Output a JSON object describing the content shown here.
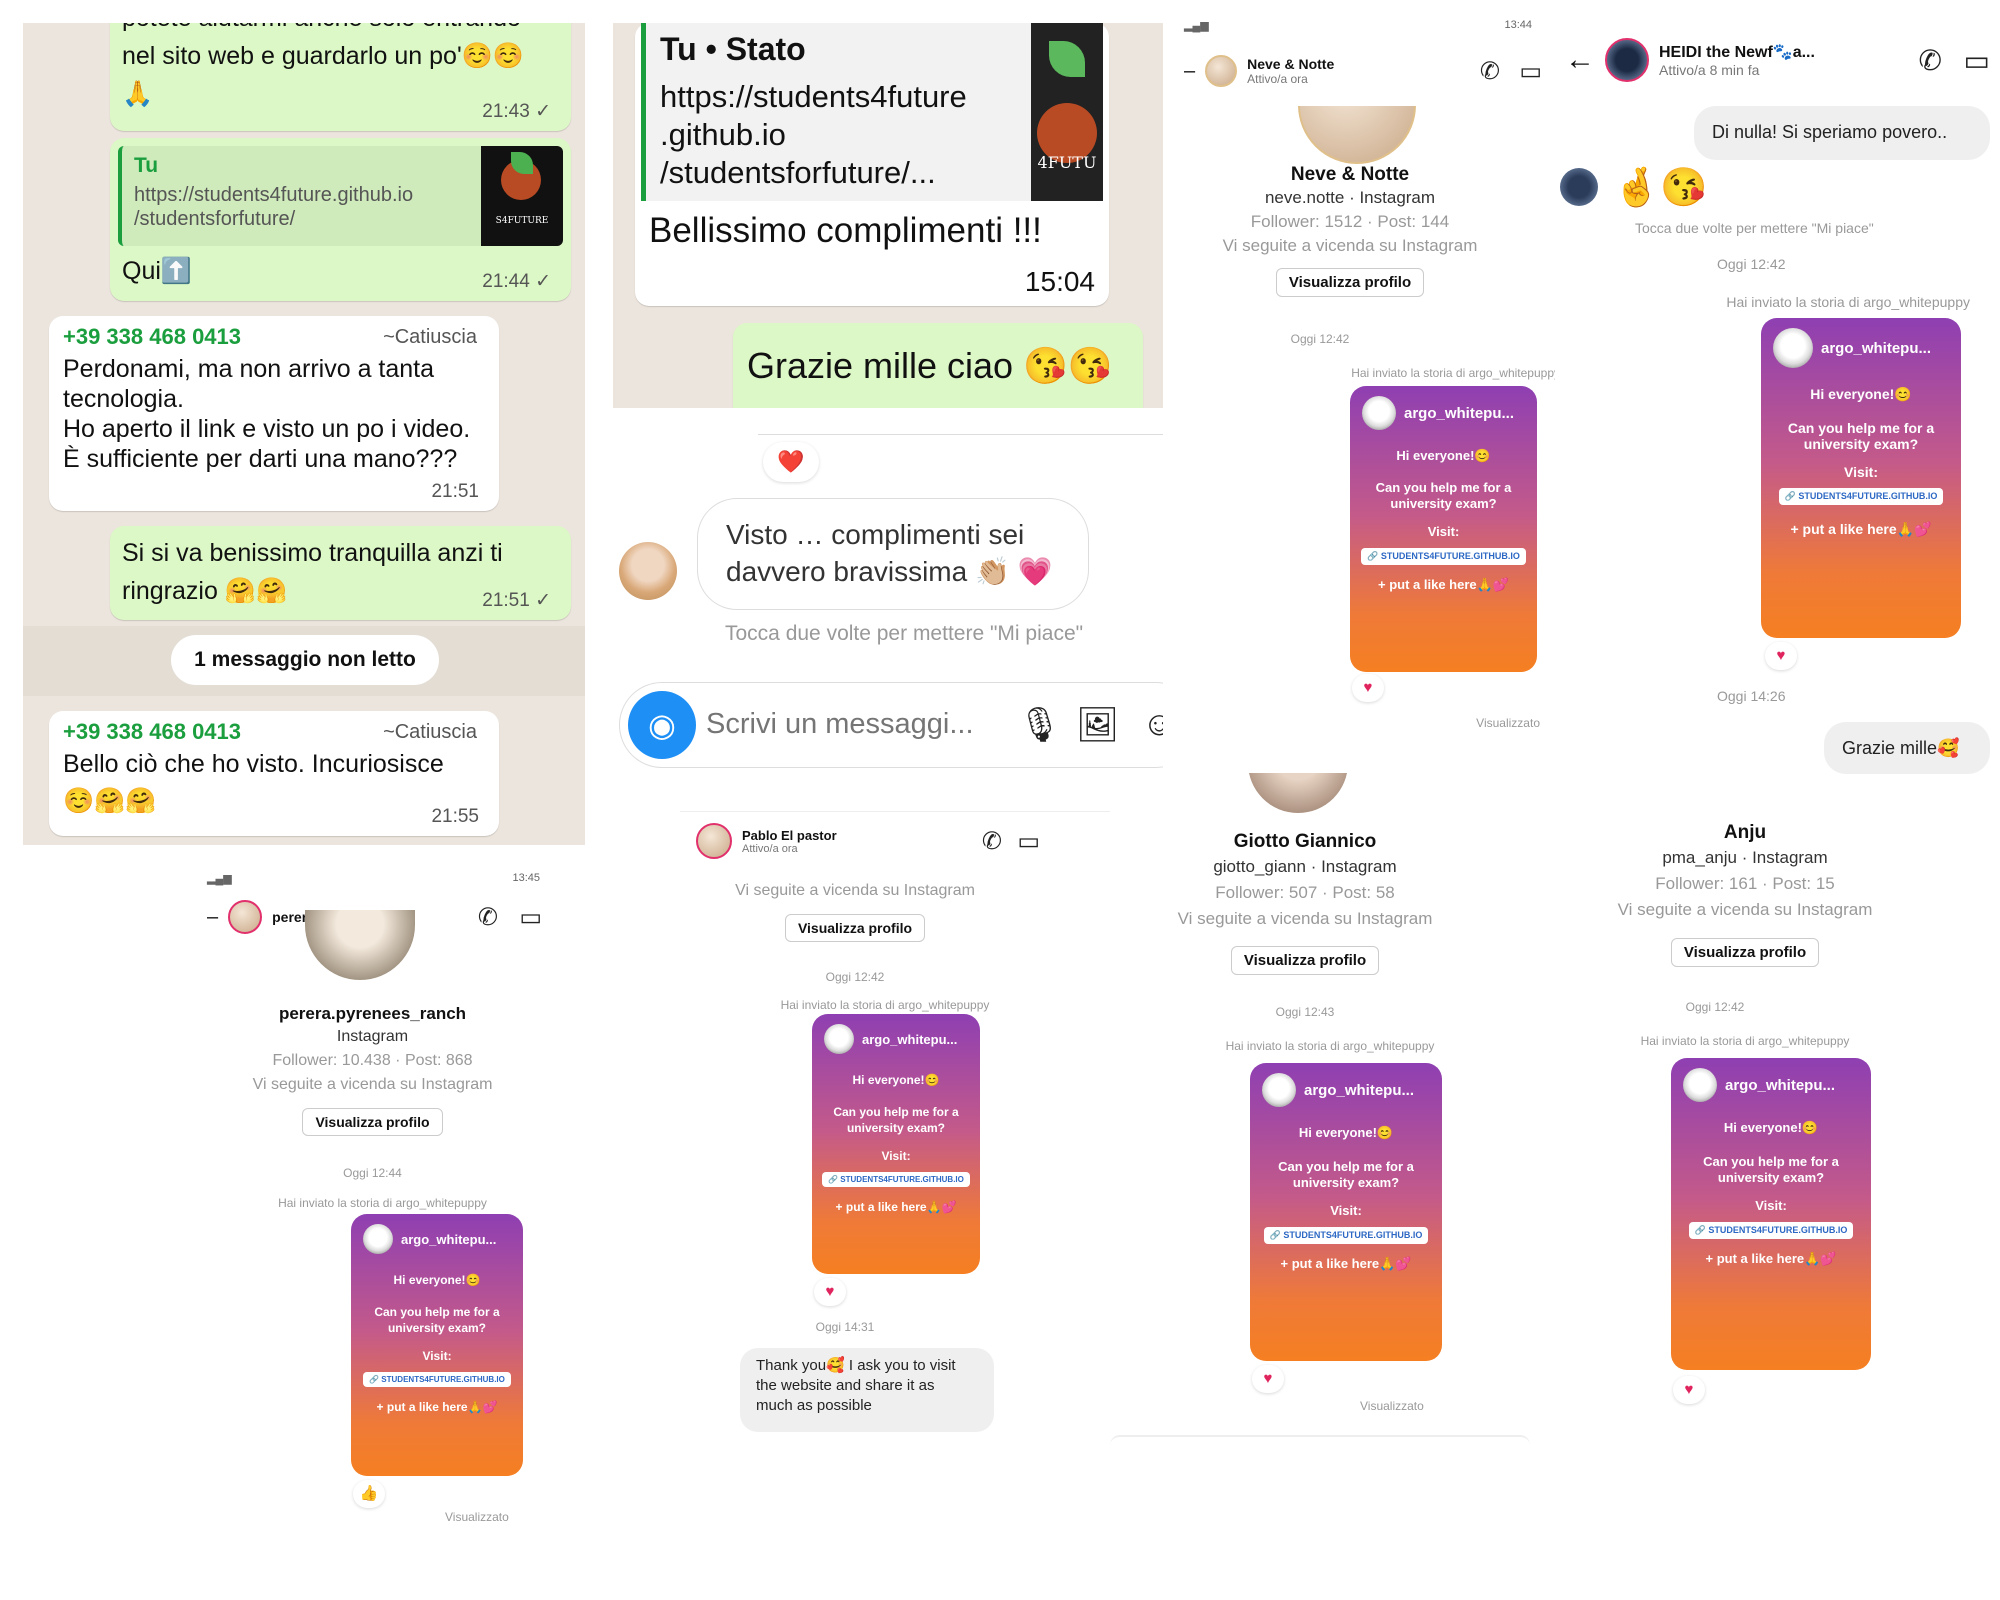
{
  "whatsapp": {
    "msg1": {
      "text_top": "potete aiutarmi anche solo entrando",
      "text": "nel sito web e guardarlo un po'☺️☺️",
      "emoji2": "🙏",
      "time": "21:43 ✓"
    },
    "msg2": {
      "quote_sender": "Tu",
      "quote_link": "https://students4future.github.io/studentsforfuture/",
      "link1": "https://students4future.github.io",
      "link2": "/studentsforfuture/",
      "text": "Qui⬆️",
      "time": "21:44 ✓",
      "logo": "S4FUTURE"
    },
    "msg3": {
      "sender": "+39 338 468 0413",
      "alias": "~Catiuscia",
      "line1": "Perdonami, ma non arrivo a tanta",
      "line2": "tecnologia.",
      "line3": "Ho aperto il link e visto un po i video.",
      "line4": "È sufficiente per darti una mano???",
      "time": "21:51"
    },
    "msg4": {
      "line1": "Si si va benissimo tranquilla anzi ti",
      "line2": "ringrazio 🤗🤗",
      "time": "21:51 ✓"
    },
    "unread": "1 messaggio non letto",
    "msg5": {
      "sender": "+39 338 468 0413",
      "alias": "~Catiuscia",
      "line1": "Bello ciò che ho visto. Incuriosisce",
      "line2": "☺️🤗🤗",
      "time": "21:55"
    }
  },
  "stato": {
    "quote_title": "Tu • Stato",
    "quote_l1": "https://students4future",
    "quote_l2": ".github.io",
    "quote_l3": "/studentsforfuture/...",
    "logo": "4FUTU",
    "text": "Bellissimo complimenti !!!",
    "time": "15:04",
    "reply": "Grazie mille ciao 😘😘",
    "heart": "❤️",
    "in_l1": "Visto … complimenti sei",
    "in_l2": "davvero bravissima 👏🏼 💗",
    "tap": "Tocca due volte per mettere \"Mi piace\"",
    "placeholder": "Scrivi un messaggi..."
  },
  "neve": {
    "status": "13:44",
    "header_name": "Neve & Notte",
    "header_sub": "Attivo/a ora",
    "name": "Neve & Notte",
    "handle": "neve.notte · Instagram",
    "stats": "Follower: 1512 · Post: 144",
    "mutual": "Vi seguite a vicenda su Instagram",
    "button": "Visualizza profilo",
    "date": "Oggi 12:42",
    "story": "Hai inviato la storia di argo_whitepuppy",
    "seen": "Visualizzato"
  },
  "heidi": {
    "header_name": "HEIDI the Newf🐾a...",
    "header_sub": "Attivo/a 8 min fa",
    "msg1": "Di nulla! Si speriamo povero..",
    "emojis": "🤞😘",
    "tap": "Tocca due volte per mettere \"Mi piace\"",
    "date1": "Oggi 12:42",
    "story": "Hai inviato la storia di argo_whitepuppy",
    "date2": "Oggi 14:26",
    "reply": "Grazie mille🥰"
  },
  "card": {
    "user": "argo_whitepu...",
    "hi": "Hi everyone!😊",
    "ask1": "Can you help me for a",
    "ask2": "university exam?",
    "visit": "Visit:",
    "link": "🔗 STUDENTS4FUTURE.GITHUB.IO",
    "like": "+ put a like here🙏💕"
  },
  "giotto": {
    "name": "Giotto Giannico",
    "handle": "giotto_giann · Instagram",
    "stats": "Follower: 507 · Post: 58",
    "mutual": "Vi seguite a vicenda su Instagram",
    "button": "Visualizza profilo",
    "date": "Oggi 12:43",
    "story": "Hai inviato la storia di argo_whitepuppy",
    "seen": "Visualizzato"
  },
  "anju": {
    "name": "Anju",
    "handle": "pma_anju · Instagram",
    "stats": "Follower: 161 · Post: 15",
    "mutual": "Vi seguite a vicenda su Instagram",
    "button": "Visualizza profilo",
    "date": "Oggi 12:42",
    "story": "Hai inviato la storia di argo_whitepuppy"
  },
  "perera": {
    "status": "13:45",
    "header_name": "perera.pyrenees_ra...",
    "name": "perera.pyrenees_ranch",
    "handle": "Instagram",
    "stats": "Follower: 10.438 · Post: 868",
    "mutual": "Vi seguite a vicenda su Instagram",
    "button": "Visualizza profilo",
    "date": "Oggi 12:44",
    "story": "Hai inviato la storia di argo_whitepuppy",
    "reaction": "👍",
    "seen": "Visualizzato"
  },
  "pablo": {
    "header_name": "Pablo El pastor",
    "header_sub": "Attivo/a ora",
    "mutual": "Vi seguite a vicenda su Instagram",
    "button": "Visualizza profilo",
    "date": "Oggi 12:42",
    "story": "Hai inviato la storia di argo_whitepuppy",
    "date2": "Oggi 14:31",
    "reply_l1": "Thank you🥰 I ask you to visit",
    "reply_l2": "the website and share it as",
    "reply_l3": "much as possible"
  }
}
